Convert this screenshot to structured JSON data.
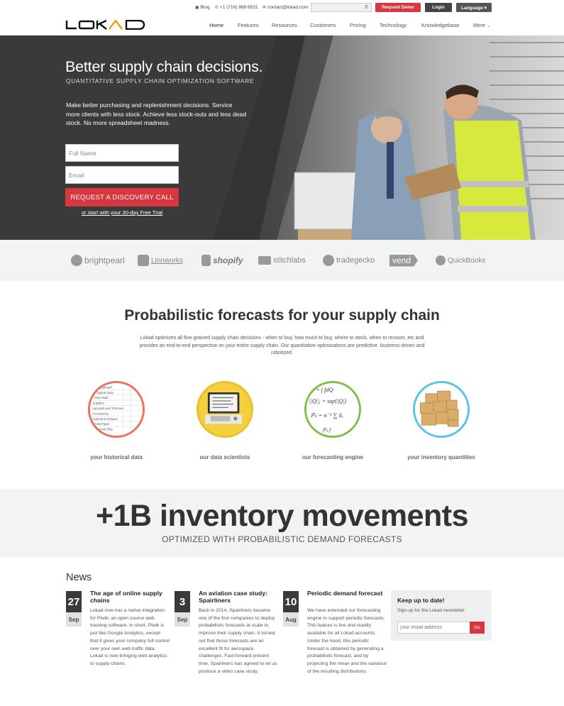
{
  "topbar": {
    "blog": "Blog",
    "phone": "+1 (716) 989 6531",
    "email": "contact@lokad.com",
    "search_placeholder": "",
    "request_demo": "Request Demo",
    "login": "Login",
    "language": "Language ▾"
  },
  "nav": {
    "items": [
      "Home",
      "Features",
      "Resources",
      "Customers",
      "Pricing",
      "Technology",
      "Knowledgebase",
      "More"
    ]
  },
  "hero": {
    "title": "Better supply chain decisions.",
    "tagline": "QUANTITATIVE SUPPLY CHAIN OPTIMIZATION SOFTWARE",
    "intro": "Make better purchasing and replenishment decisions. Service more clients with less stock. Achieve less stock-outs and less dead stock. No more spreadsheet madness.",
    "name_placeholder": "Full Name",
    "email_placeholder": "Email",
    "cta": "REQUEST A DISCOVERY CALL",
    "trial_link": "or start with your 30-day Free Trial"
  },
  "partners": [
    "brightpearl",
    "Linnworks",
    "shopify",
    "stitchlabs",
    "tradegecko",
    "vend",
    "QuickBooks"
  ],
  "forecasts": {
    "title": "Probabilistic forecasts for your supply chain",
    "description": "Lokad optimizes all fine-grained supply chain decisions - when to buy, how much to buy, where to stock, when to recount, etc and provides an end-to-end perspective on your entire supply chain. Our quantitative optimizations are predictive, business-driven and robotized.",
    "features": [
      {
        "label": "your historical data",
        "color": "#e8735c"
      },
      {
        "label": "our data scientists",
        "color": "#e8c12e"
      },
      {
        "label": "our forecasting engine",
        "color": "#7dc14b"
      },
      {
        "label": "your inventory quantities",
        "color": "#5bc3e6"
      }
    ]
  },
  "stat": {
    "big": "+1B inventory movements",
    "sub": "OPTIMIZED WITH PROBABILISTIC DEMAND FORECASTS"
  },
  "news": {
    "heading": "News",
    "items": [
      {
        "day": "27",
        "month": "Sep",
        "title": "The age of online supply chains",
        "body": "Lokad now has a native integration for Piwik, an open source web tracking software. In short, Piwik is just like Google Analytics, except that it gives your company full control over your own web traffic data. Lokad is now bringing web analytics to supply chains."
      },
      {
        "day": "3",
        "month": "Sep",
        "title": "An aviation case study: Spairliners",
        "body": "Back in 2014, Spairliners became one of the first companies to deploy probabilistic forecasts at scale to improve their supply chain. It turned out that those forecasts are an excellent fit for aerospace challenges. Fast-forward present time, Spairliners has agreed to let us produce a video case study."
      },
      {
        "day": "10",
        "month": "Aug",
        "title": "Periodic demand forecast",
        "body": "We have extended our forecasting engine to support periodic forecasts. This feature is live and readily available for all Lokad accounts. Under the hood, this periodic forecast is obtained by generating a probabilistic forecast, and by projecting the mean and the variance of the resulting distributions."
      }
    ]
  },
  "newsletter": {
    "title": "Keep up to date!",
    "subtitle": "Sign-up for the Lokad newsletter",
    "placeholder": "your email address",
    "button": "Go"
  },
  "colors": {
    "accent": "#d9373f",
    "dark": "#3b3b3b",
    "band": "#f2f3f4"
  }
}
